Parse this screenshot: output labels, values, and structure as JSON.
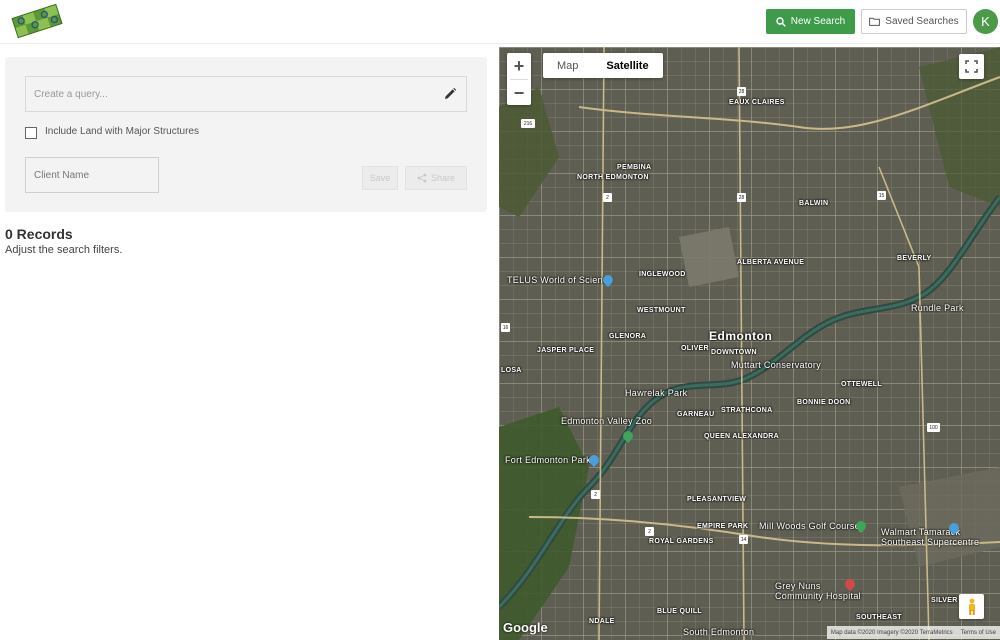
{
  "header": {
    "new_search_label": "New Search",
    "saved_searches_label": "Saved Searches",
    "avatar_letter": "K",
    "accent_color": "#3d9b4a"
  },
  "query": {
    "placeholder": "Create a query...",
    "include_structures_label": "Include Land with Major Structures",
    "client_placeholder": "Client Name",
    "save_label": "Save",
    "share_label": "Share"
  },
  "results": {
    "count_label": "0 Records",
    "hint": "Adjust the search filters."
  },
  "map": {
    "tabs": [
      {
        "label": "Map",
        "active": false
      },
      {
        "label": "Satellite",
        "active": true
      }
    ],
    "zoom_in": "+",
    "zoom_out": "−",
    "google_label": "Google",
    "attribution": [
      "Map data ©2020 Imagery ©2020 TerraMetrics",
      "Terms of Use"
    ],
    "labels": {
      "eaux_claires": "EAUX CLAIRES",
      "pembina": "PEMBINA",
      "north_edmonton": "NORTH EDMONTON",
      "balwin": "BALWIN",
      "telus": "TELUS World of Science",
      "inglewood": "INGLEWOOD",
      "alberta_avenue": "ALBERTA AVENUE",
      "beverly": "BEVERLY",
      "westmount": "WESTMOUNT",
      "rundle_park": "Rundle Park",
      "glenora": "GLENORA",
      "edmonton": "Edmonton",
      "oliver": "OLIVER",
      "downtown": "DOWNTOWN",
      "jasper_place": "JASPER PLACE",
      "muttart": "Muttart Conservatory",
      "losa": "LOSA",
      "ottewell": "OTTEWELL",
      "hawrelak": "Hawrelak Park",
      "garneau": "GARNEAU",
      "bonnie_doon": "BONNIE DOON",
      "strathcona": "STRATHCONA",
      "valley_zoo": "Edmonton Valley Zoo",
      "queen_alexandra": "QUEEN ALEXANDRA",
      "fort_edmonton": "Fort Edmonton Park",
      "pleasantview": "PLEASANTVIEW",
      "empire_park": "EMPIRE PARK",
      "mill_woods_golf": "Mill Woods Golf Course",
      "walmart": "Walmart Tamarack Southeast Supercentre",
      "royal_gardens": "ROYAL GARDENS",
      "grey_nuns": "Grey Nuns Community Hospital",
      "blue_quill": "BLUE QUILL",
      "southeast": "SOUTHEAST",
      "silver": "SILVER",
      "south_edmonton": "South Edmonton",
      "ndale": "NDALE"
    },
    "shields": {
      "s28a": "28",
      "s216": "216",
      "s2a": "2",
      "s28b": "28",
      "s15": "15",
      "s2b": "2",
      "s14": "14",
      "s2c": "2",
      "s100": "100",
      "s16": "16"
    }
  }
}
